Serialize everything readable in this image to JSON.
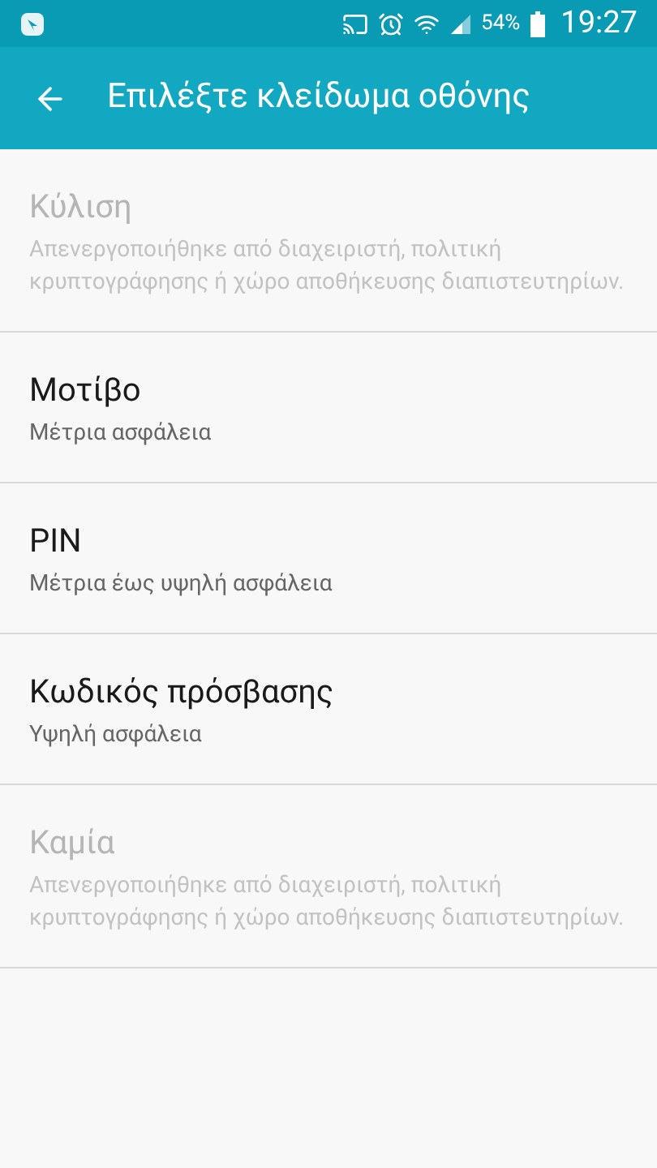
{
  "status_bar": {
    "battery": "54%",
    "time": "19:27"
  },
  "app_bar": {
    "title": "Επιλέξτε κλείδωμα οθόνης"
  },
  "options": [
    {
      "title": "Κύλιση",
      "summary": "Απενεργοποιήθηκε από διαχειριστή, πολιτική κρυπτογράφησης ή χώρο αποθήκευσης διαπιστευτηρίων.",
      "disabled": true
    },
    {
      "title": "Μοτίβο",
      "summary": "Μέτρια ασφάλεια",
      "disabled": false
    },
    {
      "title": "PIN",
      "summary": "Μέτρια έως υψηλή ασφάλεια",
      "disabled": false
    },
    {
      "title": "Κωδικός πρόσβασης",
      "summary": "Υψηλή ασφάλεια",
      "disabled": false
    },
    {
      "title": "Καμία",
      "summary": "Απενεργοποιήθηκε από διαχειριστή, πολιτική κρυπτογράφησης ή χώρο αποθήκευσης διαπιστευτηρίων.",
      "disabled": true
    }
  ]
}
